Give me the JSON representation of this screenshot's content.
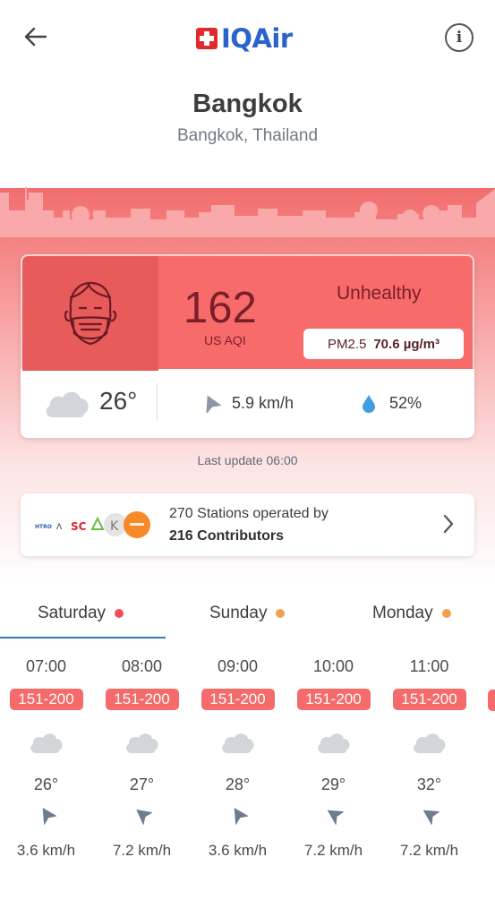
{
  "header": {
    "logo_text": "IQAir",
    "info_label": "i"
  },
  "location": {
    "city": "Bangkok",
    "region": "Bangkok, Thailand"
  },
  "aqi": {
    "value": "162",
    "unit": "US AQI",
    "status": "Unhealthy",
    "pollutant_name": "PM2.5",
    "pollutant_value": "70.6 µg/m³",
    "color": "#f86b6b"
  },
  "weather": {
    "temperature": "26°",
    "wind": "5.9 km/h",
    "humidity": "52%"
  },
  "last_update": "Last update 06:00",
  "stations": {
    "line1": "270 Stations operated by",
    "line2": "216 Contributors"
  },
  "tabs": [
    {
      "label": "Saturday",
      "dot_color": "#f0505a",
      "active": true
    },
    {
      "label": "Sunday",
      "dot_color": "#f5a04a",
      "active": false
    },
    {
      "label": "Monday",
      "dot_color": "#f5a04a",
      "active": false
    }
  ],
  "hourly": [
    {
      "time": "07:00",
      "aqi_range": "151-200",
      "temp": "26°",
      "wind": "3.6 km/h"
    },
    {
      "time": "08:00",
      "aqi_range": "151-200",
      "temp": "27°",
      "wind": "7.2 km/h"
    },
    {
      "time": "09:00",
      "aqi_range": "151-200",
      "temp": "28°",
      "wind": "3.6 km/h"
    },
    {
      "time": "10:00",
      "aqi_range": "151-200",
      "temp": "29°",
      "wind": "7.2 km/h"
    },
    {
      "time": "11:00",
      "aqi_range": "151-200",
      "temp": "32°",
      "wind": "7.2 km/h"
    }
  ]
}
